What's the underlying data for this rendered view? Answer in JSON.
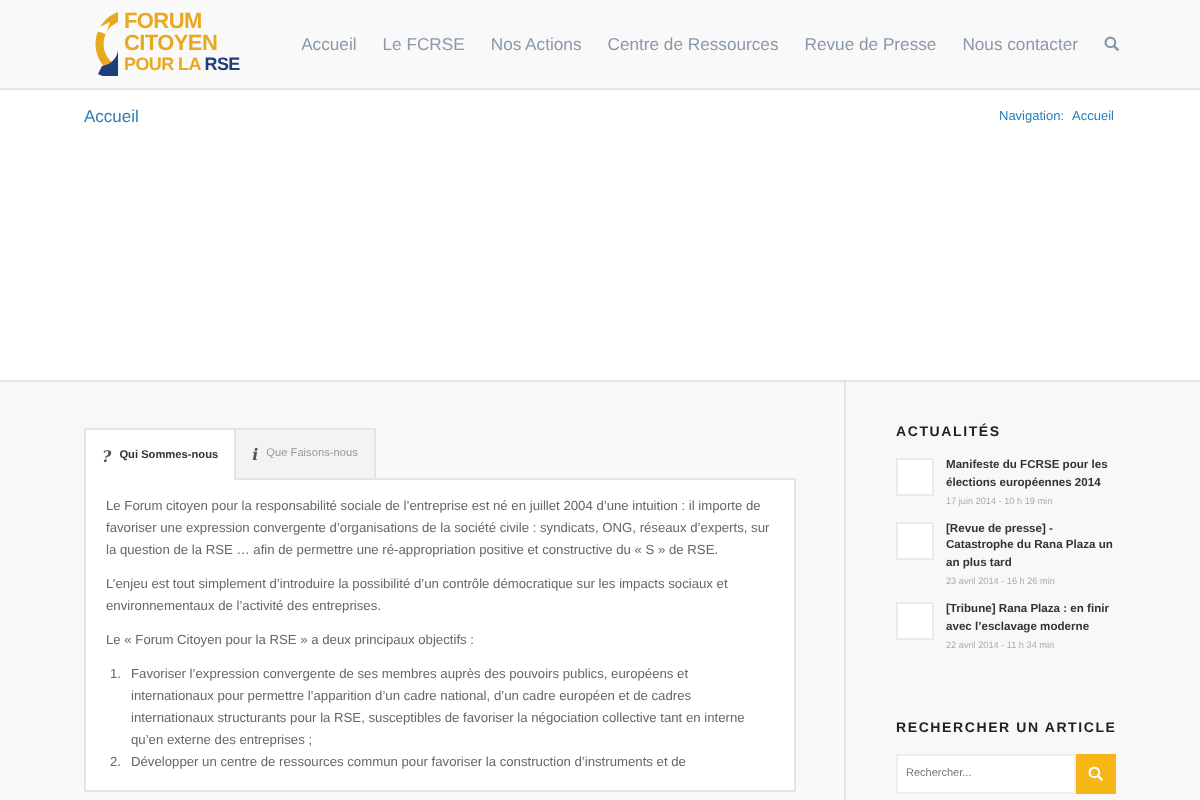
{
  "logo": {
    "lines": [
      "FORUM",
      "CITOYEN",
      "POUR LA"
    ],
    "accent": "RSE"
  },
  "nav": [
    {
      "label": "Accueil",
      "selected": false
    },
    {
      "label": "Le FCRSE",
      "selected": false
    },
    {
      "label": "Nos Actions",
      "selected": false
    },
    {
      "label": "Centre de Ressources",
      "selected": false
    },
    {
      "label": "Revue de Presse",
      "selected": false
    },
    {
      "label": "Nous contacter",
      "selected": false
    }
  ],
  "breadcrumb": {
    "title": "Accueil",
    "label": "Navigation:",
    "link": "Accueil"
  },
  "tabs": [
    {
      "label": "Qui Sommes-nous",
      "icon": "?",
      "selected": true
    },
    {
      "label": "Que Faisons-nous",
      "icon": "i",
      "selected": false
    }
  ],
  "content": {
    "paragraphs": [
      "Le Forum citoyen pour la responsabilité sociale de l’entreprise est né en juillet 2004 d’une intuition : il importe de favoriser une expression convergente d’organisations de la société civile : syndicats, ONG, réseaux d’experts, sur la question de la RSE … afin de permettre une ré-appropriation positive et constructive du « S » de RSE.",
      "L’enjeu est tout simplement d’introduire la possibilité d’un contrôle démocratique sur les impacts sociaux et environnementaux de l’activité des entreprises.",
      "Le « Forum Citoyen pour la RSE » a deux principaux objectifs :"
    ],
    "list": [
      {
        "number": "1.",
        "text": "Favoriser l’expression convergente de ses membres auprès des pouvoirs publics, européens et internationaux pour permettre l’apparition d’un cadre national, d’un cadre européen et de cadres internationaux structurants pour la RSE, susceptibles de favoriser la négociation collective tant en interne qu’en externe des entreprises ;"
      },
      {
        "number": "2.",
        "text": "Développer un centre de ressources commun pour favoriser la construction d’instruments et de"
      }
    ]
  },
  "sidebar": {
    "news_title": "ACTUALITÉS",
    "news": [
      {
        "title": "Manifeste du FCRSE pour les élections européennes 2014",
        "date": "17 juin 2014 - 10 h 19 min"
      },
      {
        "title": "[Revue de presse] - Catastrophe du Rana Plaza un an plus tard",
        "date": "23 avril 2014 - 16 h 26 min"
      },
      {
        "title": "[Tribune] Rana Plaza : en finir avec l’esclavage moderne",
        "date": "22 avril 2014 - 11 h 34 min"
      }
    ],
    "search_title": "RECHERCHER UN ARTICLE",
    "search": {
      "placeholder": "Rechercher..."
    }
  }
}
